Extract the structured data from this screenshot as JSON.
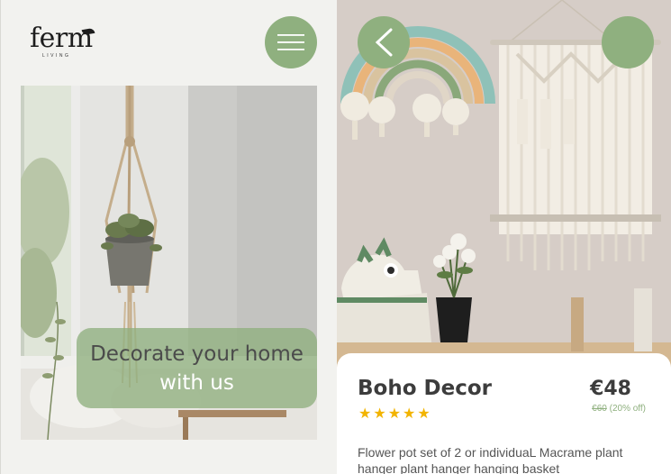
{
  "brand": {
    "logo_word": "ferm",
    "logo_sub": "LIVING"
  },
  "home": {
    "cta_line1": "Decorate your home",
    "cta_line2": "with us"
  },
  "product": {
    "name": "Boho Decor",
    "rating": 5,
    "stars": [
      "★",
      "★",
      "★",
      "★",
      "★"
    ],
    "price": "€48",
    "old_price": "€60",
    "discount": "(20% off)",
    "description": "Flower pot set of 2 or individuaL Macrame plant hanger plant hanger hanging basket"
  },
  "colors": {
    "accent": "#8fb07f",
    "star": "#f2b400",
    "left_bg": "#f2f2ef",
    "text_dark": "#3c3c3c"
  },
  "icons": {
    "menu": "hamburger-menu-icon",
    "back": "chevron-left-icon"
  }
}
